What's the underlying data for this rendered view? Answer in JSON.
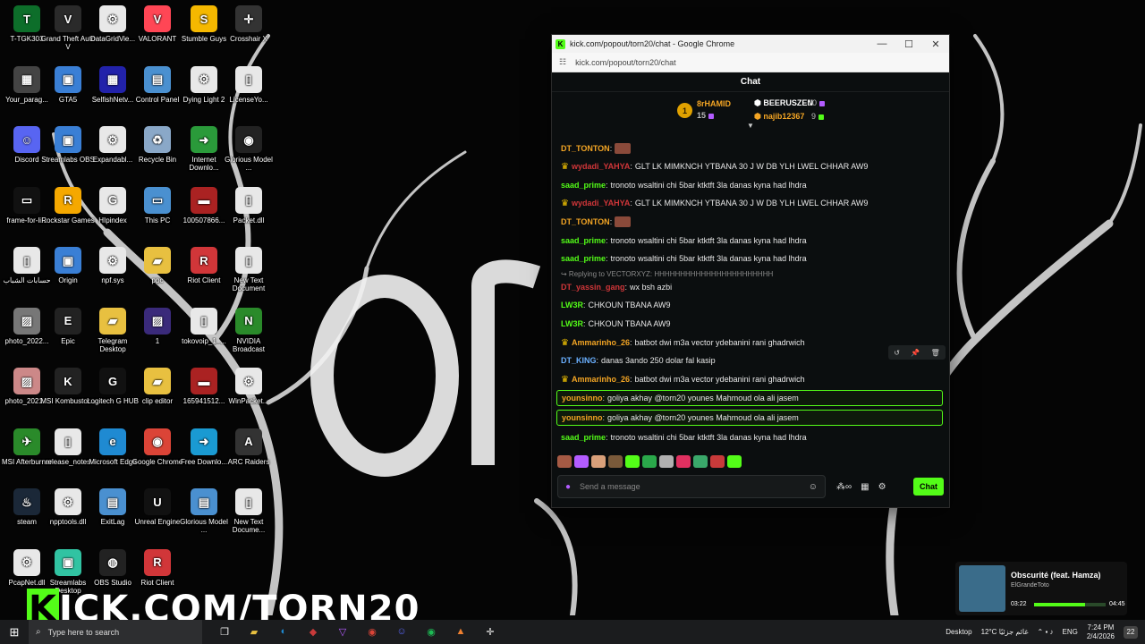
{
  "desktop_icons": [
    {
      "label": "T-TGK303",
      "color": "#0d6e2a",
      "glyph": "T"
    },
    {
      "label": "Grand Theft Auto V",
      "color": "#2a2a2a",
      "glyph": "V"
    },
    {
      "label": "DataGridVie...",
      "color": "#e8e8e8",
      "glyph": "⚙"
    },
    {
      "label": "VALORANT",
      "color": "#ff4655",
      "glyph": "V"
    },
    {
      "label": "Stumble Guys",
      "color": "#f5b800",
      "glyph": "S"
    },
    {
      "label": "Crosshair X",
      "color": "#333",
      "glyph": "✛"
    },
    {
      "label": "Your_parag...",
      "color": "#444",
      "glyph": "▦"
    },
    {
      "label": "GTA5",
      "color": "#3a7fd5",
      "glyph": "▣"
    },
    {
      "label": "SelfishNetv...",
      "color": "#2222aa",
      "glyph": "▦"
    },
    {
      "label": "Control Panel",
      "color": "#4a90d0",
      "glyph": "▤"
    },
    {
      "label": "Dying Light 2",
      "color": "#e8e8e8",
      "glyph": "⚙"
    },
    {
      "label": "LicenseYo...",
      "color": "#e8e8e8",
      "glyph": "▯"
    },
    {
      "label": "Discord",
      "color": "#5865f2",
      "glyph": "☺"
    },
    {
      "label": "Streamlabs OBS",
      "color": "#3a7fd5",
      "glyph": "▣"
    },
    {
      "label": "Expandabl...",
      "color": "#e8e8e8",
      "glyph": "⚙"
    },
    {
      "label": "Recycle Bin",
      "color": "#8aa8c8",
      "glyph": "♻"
    },
    {
      "label": "Internet Downlo...",
      "color": "#2a9a3a",
      "glyph": "➜"
    },
    {
      "label": "Glorious Model ...",
      "color": "#222",
      "glyph": "◉"
    },
    {
      "label": "frame-for-li...",
      "color": "#111",
      "glyph": "▭"
    },
    {
      "label": "Rockstar Games",
      "color": "#f5a800",
      "glyph": "R"
    },
    {
      "label": "HIpindex",
      "color": "#e8e8e8",
      "glyph": "G"
    },
    {
      "label": "This PC",
      "color": "#4a90d0",
      "glyph": "▭"
    },
    {
      "label": "100507866...",
      "color": "#aa2222",
      "glyph": "▬"
    },
    {
      "label": "Packet.dll",
      "color": "#e8e8e8",
      "glyph": "▯"
    },
    {
      "label": "حسابات الشباب",
      "color": "#e8e8e8",
      "glyph": "▯"
    },
    {
      "label": "Origin",
      "color": "#3a7fd5",
      "glyph": "▣"
    },
    {
      "label": "npf.sys",
      "color": "#e8e8e8",
      "glyph": "⚙"
    },
    {
      "label": "ppc",
      "color": "#e8c040",
      "glyph": "▰"
    },
    {
      "label": "Riot Client",
      "color": "#d13639",
      "glyph": "R"
    },
    {
      "label": "New Text Document",
      "color": "#e8e8e8",
      "glyph": "▯"
    },
    {
      "label": "photo_2022...",
      "color": "#777",
      "glyph": "▨"
    },
    {
      "label": "Epic",
      "color": "#222",
      "glyph": "E"
    },
    {
      "label": "Telegram Desktop",
      "color": "#e8c040",
      "glyph": "▰"
    },
    {
      "label": "1",
      "color": "#3a2a7a",
      "glyph": "▨"
    },
    {
      "label": "tokovoip_1_...",
      "color": "#e8e8e8",
      "glyph": "▯"
    },
    {
      "label": "NVIDIA Broadcast",
      "color": "#2a8a2a",
      "glyph": "N"
    },
    {
      "label": "photo_2021...",
      "color": "#c88",
      "glyph": "▨"
    },
    {
      "label": "MSI Kombustor...",
      "color": "#222",
      "glyph": "K"
    },
    {
      "label": "Logitech G HUB",
      "color": "#111",
      "glyph": "G"
    },
    {
      "label": "clip editor",
      "color": "#e8c040",
      "glyph": "▰"
    },
    {
      "label": "165941512...",
      "color": "#aa2222",
      "glyph": "▬"
    },
    {
      "label": "WinPacket...",
      "color": "#e8e8e8",
      "glyph": "⚙"
    },
    {
      "label": "MSI Afterburner",
      "color": "#2a8a2a",
      "glyph": "✈"
    },
    {
      "label": "release_notes",
      "color": "#e8e8e8",
      "glyph": "▯"
    },
    {
      "label": "Microsoft Edge",
      "color": "#1f8ad2",
      "glyph": "e"
    },
    {
      "label": "Google Chrome",
      "color": "#db4437",
      "glyph": "◉"
    },
    {
      "label": "Free Downlo...",
      "color": "#1a9ad2",
      "glyph": "➜"
    },
    {
      "label": "ARC Raiders",
      "color": "#333",
      "glyph": "A"
    },
    {
      "label": "steam",
      "color": "#1b2838",
      "glyph": "♨"
    },
    {
      "label": "npptools.dll",
      "color": "#e8e8e8",
      "glyph": "⚙"
    },
    {
      "label": "ExitLag",
      "color": "#4a90d0",
      "glyph": "▤"
    },
    {
      "label": "Unreal Engine",
      "color": "#111",
      "glyph": "U"
    },
    {
      "label": "Glorious Model ...",
      "color": "#4a90d0",
      "glyph": "▤"
    },
    {
      "label": "New Text Docume...",
      "color": "#e8e8e8",
      "glyph": "▯"
    },
    {
      "label": "PcapNet.dll",
      "color": "#e8e8e8",
      "glyph": "⚙"
    },
    {
      "label": "Streamlabs Desktop",
      "color": "#31c3a2",
      "glyph": "▣"
    },
    {
      "label": "OBS Studio",
      "color": "#222",
      "glyph": "◍"
    },
    {
      "label": "Riot Client",
      "color": "#d13639",
      "glyph": "R"
    }
  ],
  "window": {
    "title": "kick.com/popout/torn20/chat - Google Chrome",
    "url": "kick.com/popout/torn20/chat",
    "minimize": "—",
    "maximize": "☐",
    "close": "✕"
  },
  "chat": {
    "header": "Chat",
    "leaders": {
      "rank": "1",
      "first_name": "8rHAMID",
      "first_count": "15",
      "second_name": "BEERUSZEN",
      "second_count": "10",
      "third_name": "najib12367",
      "third_count": "9"
    },
    "messages": [
      {
        "user": "DT_TONTON",
        "color": "#f3a524",
        "text": "",
        "crown": false,
        "emote": true,
        "hl": false
      },
      {
        "user": "wydadi_YAHYA",
        "color": "#d13639",
        "text": "GLT LK MIMKNCH YTBANA 30 J W DB YLH LWEL CHHAR AW9",
        "crown": true,
        "emote": false,
        "hl": false
      },
      {
        "user": "saad_prime",
        "color": "#53fc18",
        "text": "tronoto wsaltini chi 5bar ktktft 3la danas kyna had lhdra",
        "crown": false,
        "emote": false,
        "hl": false
      },
      {
        "user": "wydadi_YAHYA",
        "color": "#d13639",
        "text": "GLT LK MIMKNCH YTBANA 30 J W DB YLH LWEL CHHAR AW9",
        "crown": true,
        "emote": false,
        "hl": false
      },
      {
        "user": "DT_TONTON",
        "color": "#f3a524",
        "text": "",
        "crown": false,
        "emote": true,
        "hl": false
      },
      {
        "user": "saad_prime",
        "color": "#53fc18",
        "text": "tronoto wsaltini chi 5bar ktktft 3la danas kyna had lhdra",
        "crown": false,
        "emote": false,
        "hl": false
      },
      {
        "user": "saad_prime",
        "color": "#53fc18",
        "text": "tronoto wsaltini chi 5bar ktktft 3la danas kyna had lhdra",
        "crown": false,
        "emote": false,
        "hl": false
      },
      {
        "user": "DT_yassin_gang",
        "color": "#d13639",
        "text": "wx bsh azbi",
        "crown": false,
        "emote": false,
        "hl": false
      },
      {
        "user": "LW3R",
        "color": "#53fc18",
        "text": "CHKOUN TBANA AW9",
        "crown": false,
        "emote": false,
        "hl": false
      },
      {
        "user": "LW3R",
        "color": "#53fc18",
        "text": "CHKOUN TBANA AW9",
        "crown": false,
        "emote": false,
        "hl": false
      },
      {
        "user": "Ammarinho_26",
        "color": "#f3a524",
        "text": "batbot dwi m3a vector ydebanini rani ghadrwich",
        "crown": true,
        "emote": false,
        "hl": false
      },
      {
        "user": "DT_KING",
        "color": "#6ab0ff",
        "text": "danas 3ando 250 dolar fal kasip",
        "crown": false,
        "emote": false,
        "hl": false
      },
      {
        "user": "Ammarinho_26",
        "color": "#f3a524",
        "text": "batbot dwi m3a vector ydebanini rani ghadrwich",
        "crown": true,
        "emote": false,
        "hl": false
      },
      {
        "user": "younsinno",
        "color": "#f3a524",
        "text": "goliya akhay @torn20 younes Mahmoud ola ali jasem",
        "crown": false,
        "emote": false,
        "hl": true
      },
      {
        "user": "younsinno",
        "color": "#f3a524",
        "text": "goliya akhay @torn20 younes Mahmoud ola ali jasem",
        "crown": false,
        "emote": false,
        "hl": true
      },
      {
        "user": "saad_prime",
        "color": "#53fc18",
        "text": "tronoto wsaltini chi 5bar ktktft 3la danas kyna had lhdra",
        "crown": false,
        "emote": false,
        "hl": false
      }
    ],
    "reply_note": "↪ Replying to VECTORXYZ: HHHHHHHHHHHHHHHHHHHHHHH",
    "placeholder": "Send a message",
    "send_label": "Chat"
  },
  "watermark": {
    "k": "K",
    "rest": "ICK.COM/TORN20"
  },
  "media": {
    "song": "Obscurité (feat. Hamza)",
    "artist": "ElGrandeToto",
    "elapsed": "03:22",
    "duration": "04:45",
    "progress": 0.71
  },
  "taskbar": {
    "search_placeholder": "Type here to search",
    "desktop_label": "Desktop",
    "weather": "12°C غائم جزئيًا",
    "lang": "ENG",
    "time": "7:24 PM",
    "date": "2/4/2026",
    "notif_count": "22"
  }
}
